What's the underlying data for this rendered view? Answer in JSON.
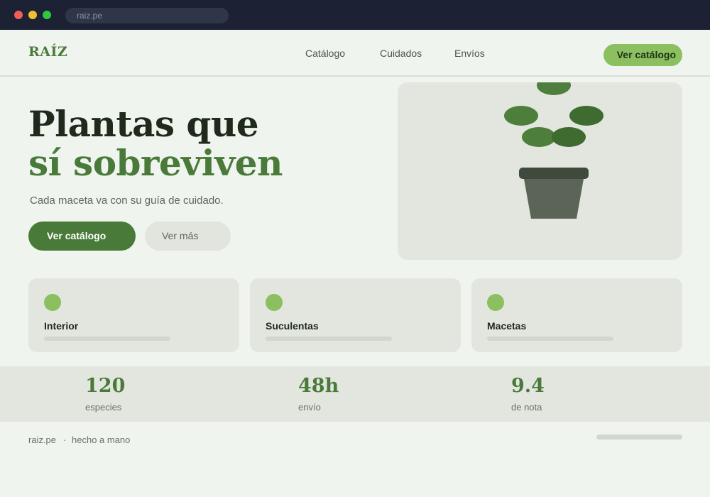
{
  "browser": {
    "url": "raiz.pe"
  },
  "nav": {
    "logo": "RAÍZ",
    "links": [
      "Catálogo",
      "Cuidados",
      "Envíos"
    ],
    "cta": "Ver catálogo"
  },
  "hero": {
    "title_line1": "Plantas que",
    "title_line2": "sí sobreviven",
    "subtitle": "Cada maceta va con su guía de cuidado.",
    "primary_button": "Ver catálogo",
    "secondary_button": "Ver más"
  },
  "categories": [
    {
      "label": "Interior"
    },
    {
      "label": "Suculentas"
    },
    {
      "label": "Macetas"
    }
  ],
  "stats": [
    {
      "value": "120",
      "label": "especies"
    },
    {
      "value": "48h",
      "label": "envío"
    },
    {
      "value": "9.4",
      "label": "de nota"
    }
  ],
  "footer": {
    "site": "raiz.pe",
    "separator": "·",
    "tagline": "hecho a mano"
  },
  "colors": {
    "brand_green": "#4a7a3a",
    "accent_green": "#8cbf5f",
    "background": "#f0f4ee",
    "panel": "#e2e6df"
  }
}
